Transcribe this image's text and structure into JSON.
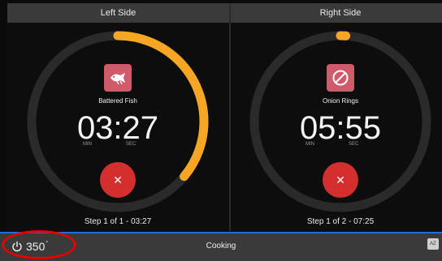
{
  "panels": {
    "left": {
      "title": "Left Side",
      "food": "Battered Fish",
      "time": "03:27",
      "min_label": "MIN",
      "sec_label": "SEC",
      "step": "Step 1 of 1 - 03:27",
      "progress": 0.36,
      "food_icon": "fish-food-icon"
    },
    "right": {
      "title": "Right Side",
      "food": "Onion Rings",
      "time": "05:55",
      "min_label": "MIN",
      "sec_label": "SEC",
      "step": "Step 1 of 2 - 07:25",
      "progress": 0.01,
      "food_icon": "no-symbol-icon"
    }
  },
  "bottom_bar": {
    "temperature": "350",
    "temp_unit": "°",
    "status": "Cooking",
    "az_label": "AZ"
  },
  "colors": {
    "arc": "#f6a623",
    "tile": "#cf5b6a",
    "cancel": "#d32f2f",
    "highlight_ring": "#e20000",
    "bar_accent": "#1f6fd6"
  }
}
